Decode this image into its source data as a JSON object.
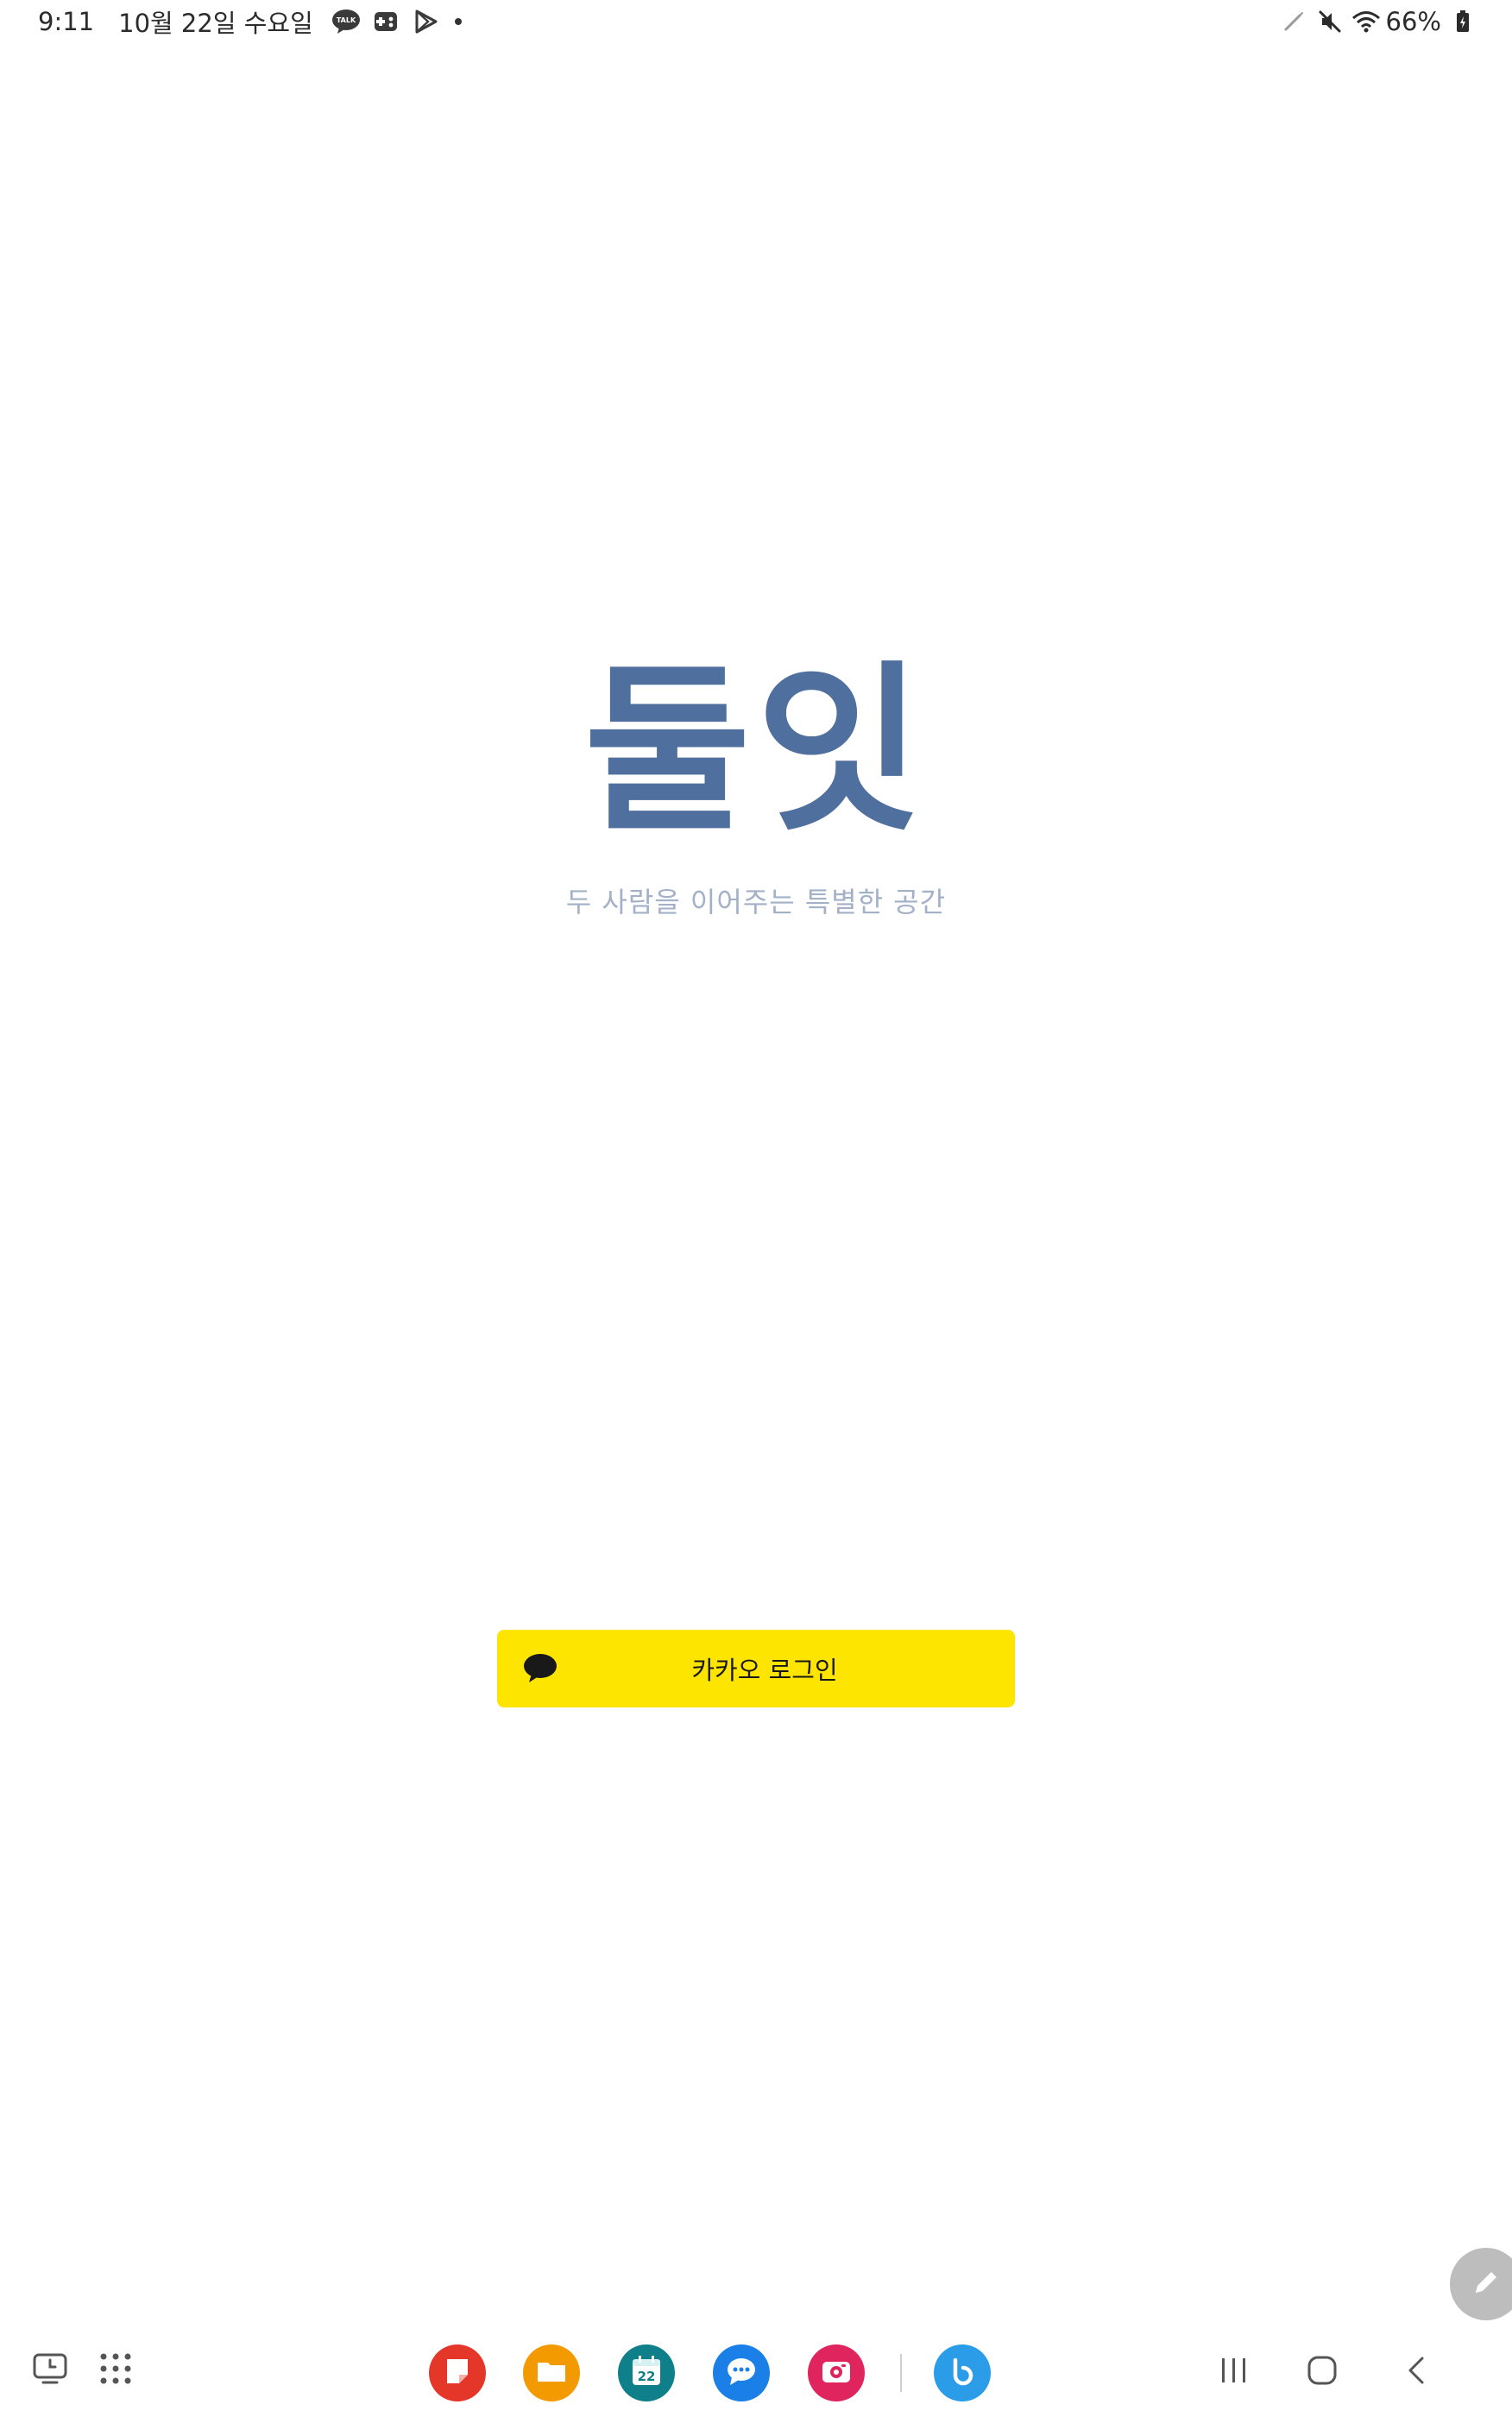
{
  "status_bar": {
    "time": "9:11",
    "date": "10월 22일 수요일",
    "notifications": [
      "kakaotalk-icon",
      "game-icon",
      "play-store-icon"
    ],
    "system_icons": [
      "stylus-icon",
      "mute-icon",
      "wifi-icon",
      "battery-icon"
    ],
    "battery_percent": "66%"
  },
  "app": {
    "title": "둘잇",
    "subtitle": "두 사람을 이어주는 특별한 공간",
    "title_color": "#4f6f9e",
    "subtitle_color": "#a3b1c8"
  },
  "login": {
    "kakao_label": "카카오 로그인",
    "button_color": "#fee500"
  },
  "taskbar": {
    "left_buttons": [
      "recent-apps-history-icon",
      "app-drawer-icon"
    ],
    "dock_apps": [
      {
        "name": "samsung-notes",
        "color": "#e5362a"
      },
      {
        "name": "my-files",
        "color": "#f29a00"
      },
      {
        "name": "calendar",
        "color": "#0f7f8a",
        "label": "22"
      },
      {
        "name": "messages",
        "color": "#1a7fe6"
      },
      {
        "name": "screen-recorder",
        "color": "#e0245e"
      },
      {
        "name": "bixby",
        "color": "#2a9ce8"
      }
    ],
    "nav_buttons": [
      "recents-icon",
      "home-icon",
      "back-icon"
    ]
  }
}
